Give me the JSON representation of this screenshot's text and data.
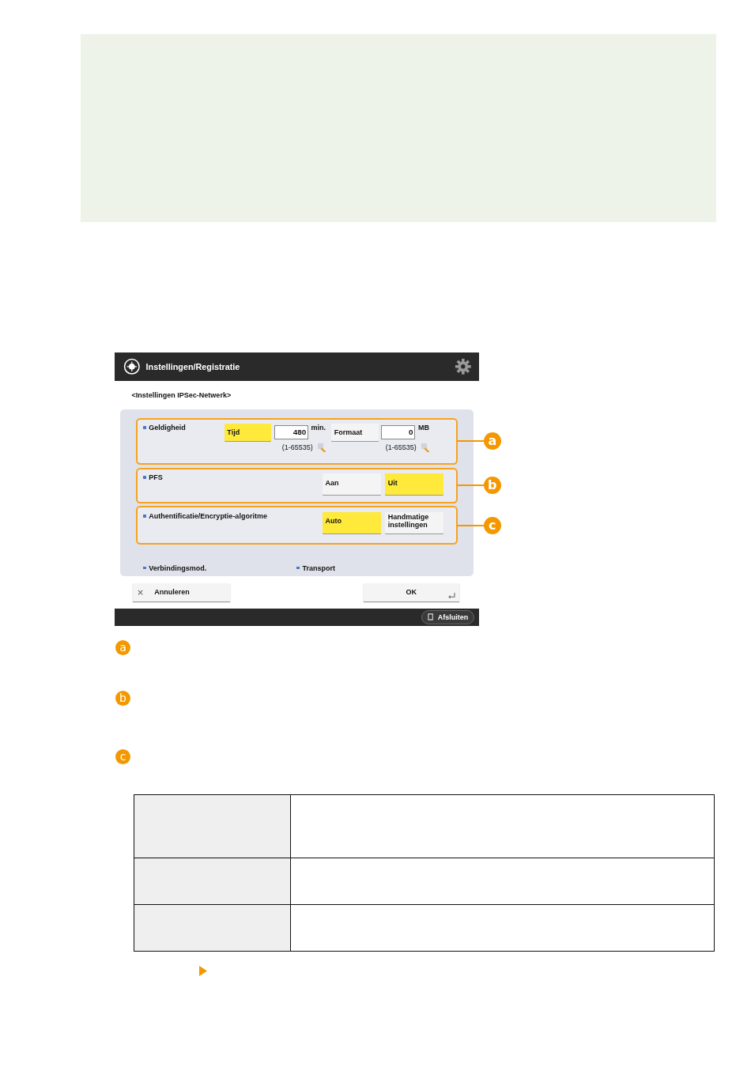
{
  "screen": {
    "title": "Instellingen/Registratie",
    "subtitle": "<Instellingen IPSec-Netwerk>",
    "rows": [
      {
        "kind": "validity",
        "label": "Geldigheid",
        "callout": "a",
        "options": [
          {
            "label": "Tijd",
            "selected": true,
            "value": "480",
            "unit": "min.",
            "range": "(1-65535)"
          },
          {
            "label": "Formaat",
            "selected": false,
            "value": "0",
            "unit": "MB",
            "range": "(1-65535)"
          }
        ]
      },
      {
        "kind": "toggle",
        "label": "PFS",
        "callout": "b",
        "options": [
          {
            "label": "Aan",
            "selected": false
          },
          {
            "label": "Uit",
            "selected": true
          }
        ]
      },
      {
        "kind": "toggle",
        "label": "Authentificatie/Encryptie-algoritme",
        "callout": "c",
        "options": [
          {
            "label": "Auto",
            "selected": true
          },
          {
            "label": "Handmatige instellingen",
            "selected": false
          }
        ]
      },
      {
        "kind": "info",
        "label": "Verbindingsmod.",
        "value": "Transport"
      }
    ],
    "cancel": "Annuleren",
    "ok": "OK",
    "exit": "Afsluiten"
  },
  "legend": [
    {
      "letter": "a"
    },
    {
      "letter": "b"
    },
    {
      "letter": "c"
    }
  ],
  "table": {
    "rows": [
      {
        "kind": "tall"
      },
      {
        "kind": "short"
      },
      {
        "kind": "short"
      }
    ]
  }
}
